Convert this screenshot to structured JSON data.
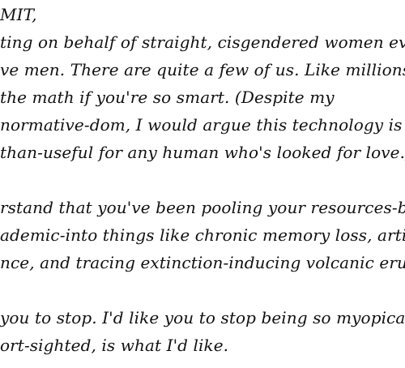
{
  "letter": {
    "salutation": "MIT,",
    "paragraphs": [
      {
        "lines": [
          "ting on behalf of straight, cisgendered women everywhe",
          "ve men. There are quite a few of us. Like millions and mi",
          " the math if you're so smart. (Despite my",
          "normative-dom, I would argue this technology is",
          "than-useful for any human who's looked for love.)"
        ]
      },
      {
        "lines": [
          "rstand that you've been pooling your resources-both fisc",
          "ademic-into things like chronic memory loss, artificial",
          "nce, and tracing extinction-inducing volcanic eruptions."
        ]
      },
      {
        "lines": [
          "you to stop. I'd like you to stop being so myopically selfis",
          "ort-sighted, is what I'd like."
        ]
      }
    ]
  }
}
